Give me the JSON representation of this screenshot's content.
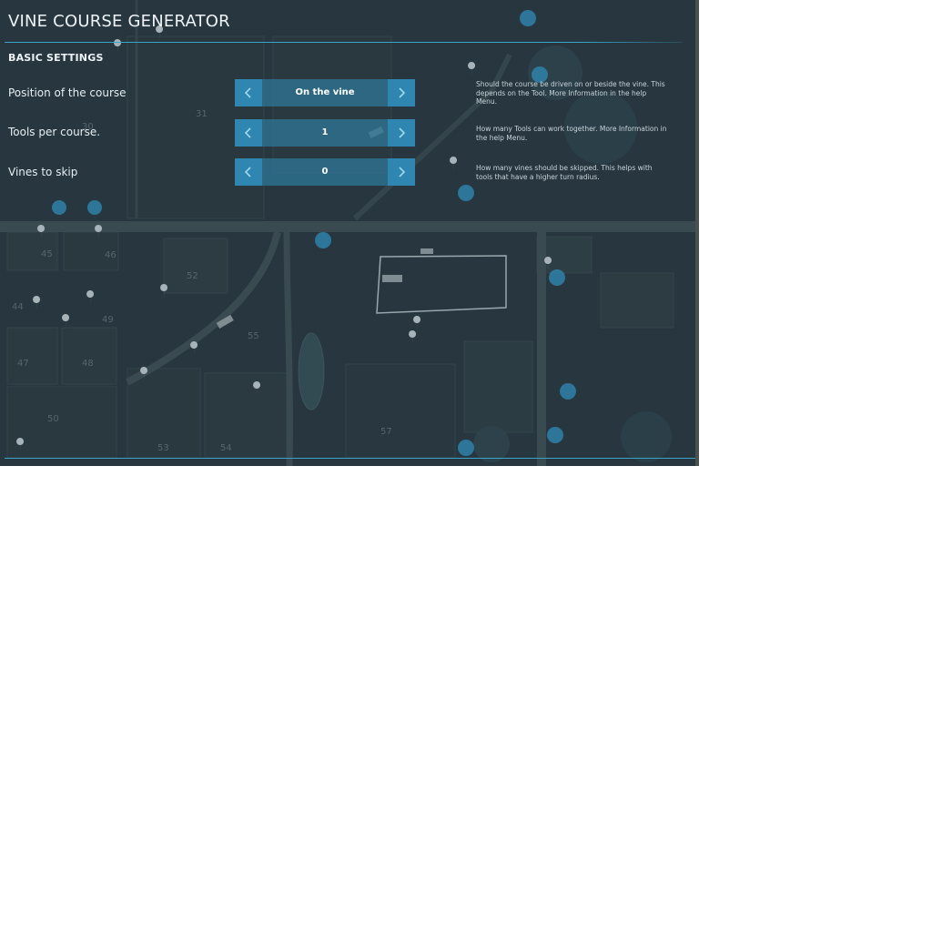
{
  "header": {
    "title": "VINE COURSE GENERATOR"
  },
  "section": {
    "title": "BASIC SETTINGS"
  },
  "settings": [
    {
      "label": "Position of the course",
      "value": "On the vine",
      "help": "Should the course be driven on or beside the vine. This depends on the Tool. More Information in the help Menu."
    },
    {
      "label": "Tools per course.",
      "value": "1",
      "help": "How many Tools can work together. More Information in the help Menu."
    },
    {
      "label": "Vines to skip",
      "value": "0",
      "help": "How many vines should be skipped. This helps with tools that have a higher turn radius."
    }
  ],
  "map": {
    "field_numbers": [
      "30",
      "31",
      "45",
      "46",
      "52",
      "44",
      "49",
      "47",
      "48",
      "55",
      "50",
      "53",
      "54",
      "57"
    ]
  },
  "colors": {
    "accent": "#3aa3c8",
    "button": "#2f86b0",
    "selector_bg": "#2e7494",
    "map_dark": "#243540"
  },
  "icons": {
    "arrow_left": "chevron-left-icon",
    "arrow_right": "chevron-right-icon"
  }
}
